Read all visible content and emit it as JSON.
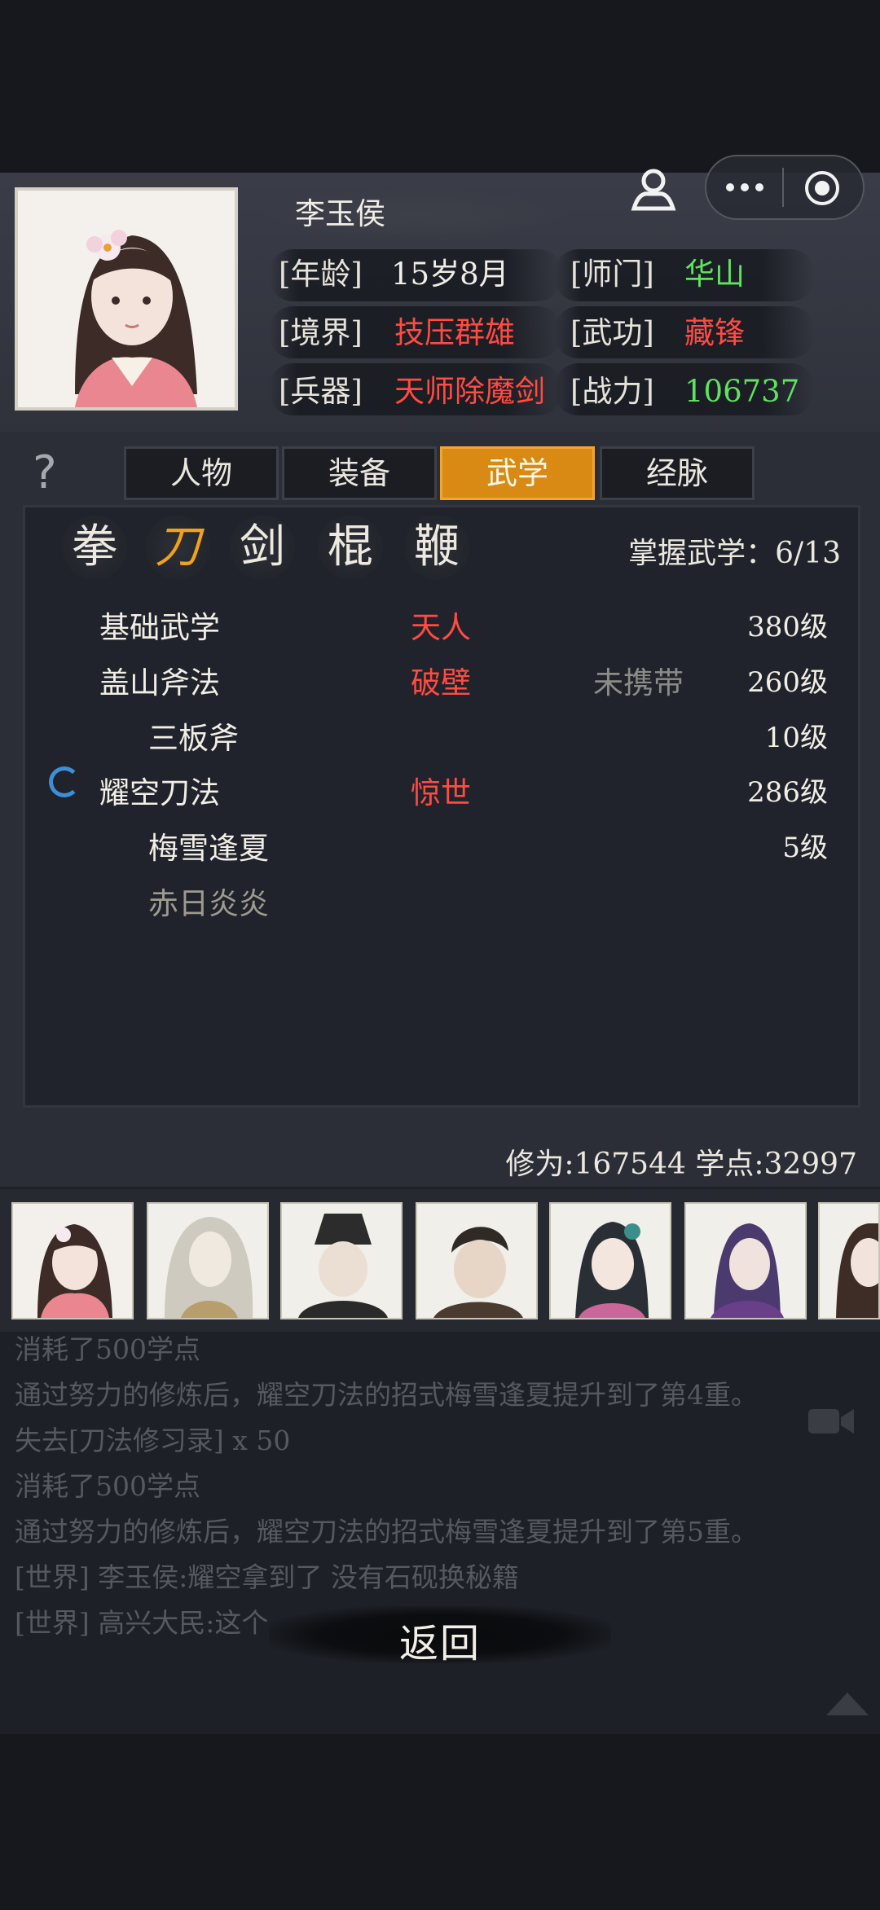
{
  "character": {
    "name": "李玉侯",
    "fields": [
      {
        "label": "[年龄]",
        "value": "15岁8月"
      },
      {
        "label": "[师门]",
        "value": "华山"
      },
      {
        "label": "[境界]",
        "value": "技压群雄"
      },
      {
        "label": "[武功]",
        "value": "藏锋"
      },
      {
        "label": "[兵器]",
        "value": "天师除魔剑"
      },
      {
        "label": "[战力]",
        "value": "106737"
      }
    ]
  },
  "tabs": [
    "人物",
    "装备",
    "武学",
    "经脉"
  ],
  "active_tab": "武学",
  "help_label": "?",
  "categories": [
    "拳",
    "刀",
    "剑",
    "棍",
    "鞭"
  ],
  "active_category": "刀",
  "mastery_text": "掌握武学：6/13",
  "skills": [
    {
      "name": "基础武学",
      "tier": "天人",
      "status": "",
      "level": "380级"
    },
    {
      "name": "盖山斧法",
      "tier": "破壁",
      "status": "未携带",
      "level": "260级"
    },
    {
      "name": "三板斧",
      "tier": "",
      "status": "",
      "level": "10级"
    },
    {
      "name": "耀空刀法",
      "tier": "惊世",
      "status": "",
      "level": "286级"
    },
    {
      "name": "梅雪逢夏",
      "tier": "",
      "status": "",
      "level": "5级"
    },
    {
      "name": "赤日炎炎",
      "tier": "",
      "status": "",
      "level": ""
    }
  ],
  "stats_text": "修为:167544  学点:32997",
  "chat": [
    "消耗了500学点",
    "通过努力的修炼后，耀空刀法的招式梅雪逢夏提升到了第4重。",
    "失去[刀法修习录] x 50",
    "消耗了500学点",
    "通过努力的修炼后，耀空刀法的招式梅雪逢夏提升到了第5重。",
    "[世界] 李玉侯:耀空拿到了 没有石砚换秘籍",
    "[世界] 高兴大民:这个"
  ],
  "back_label": "返回",
  "colors": {
    "accent_tab": "#d88a14",
    "tier_red": "#ff4b42",
    "sect_green": "#5fe35f"
  }
}
